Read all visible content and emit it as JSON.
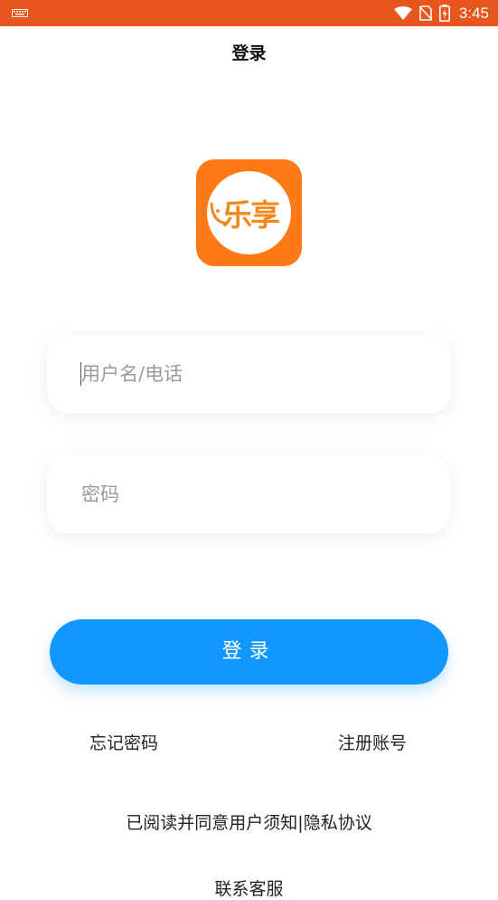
{
  "status_bar": {
    "time": "3:45",
    "background": "#e9561d"
  },
  "page": {
    "title": "登录"
  },
  "logo": {
    "text": "乐享",
    "background": "#ff7a17"
  },
  "form": {
    "username_placeholder": "用户名/电话",
    "username_value": "",
    "password_placeholder": "密码",
    "password_value": "",
    "login_label": "登录",
    "login_color": "#1296ff"
  },
  "links": {
    "forgot_password": "忘记密码",
    "register": "注册账号"
  },
  "agreement": {
    "prefix": "已阅读并同意",
    "user_terms": "用户须知",
    "separator": "|",
    "privacy": "隐私协议"
  },
  "support": {
    "label": "联系客服"
  }
}
